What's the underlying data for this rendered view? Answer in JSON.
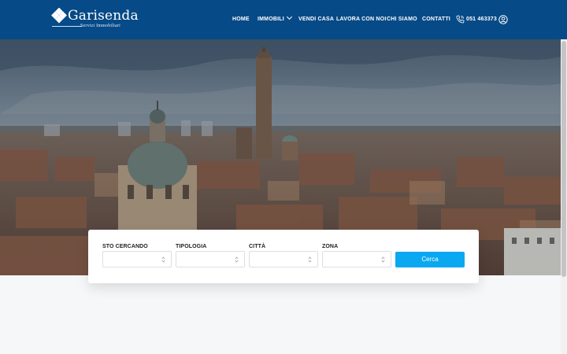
{
  "brand": {
    "name": "Garisenda",
    "tagline": "Servizi Immobiliari",
    "logo_icon": "diamond-logo-icon",
    "color": "#064a87"
  },
  "nav": {
    "items": [
      {
        "label": "HOME"
      },
      {
        "label": "IMMOBILI",
        "icon": "chevron-down-icon"
      },
      {
        "label": "VENDI CASA"
      },
      {
        "label": "LAVORA CON NOI"
      },
      {
        "label": "CHI SIAMO"
      },
      {
        "label": "CONTATTI"
      }
    ],
    "phone": {
      "icon": "phone-icon",
      "number": "051 463373"
    },
    "account_icon": "user-circle-icon"
  },
  "hero": {
    "image": "bologna-rooftops-with-towers"
  },
  "search": {
    "fields": [
      {
        "label": "STO CERCANDO",
        "value": ""
      },
      {
        "label": "TIPOLOGIA",
        "value": ""
      },
      {
        "label": "CITTÀ",
        "value": ""
      },
      {
        "label": "ZONA",
        "value": ""
      }
    ],
    "button_label": "Cerca",
    "button_color": "#0aa8f0"
  }
}
